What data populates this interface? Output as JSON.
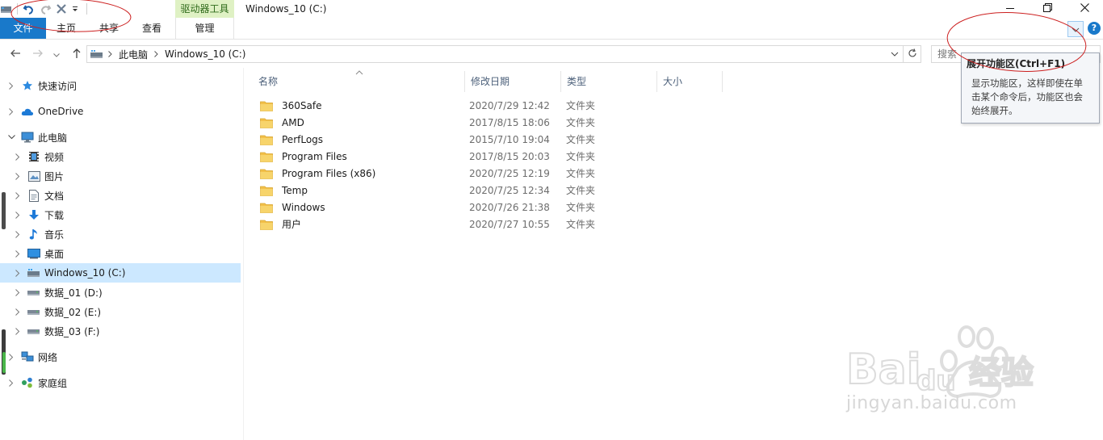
{
  "window": {
    "title": "Windows_10 (C:)",
    "context_tab_header": "驱动器工具"
  },
  "ribbon": {
    "tabs": [
      "文件",
      "主页",
      "共享",
      "查看",
      "管理"
    ]
  },
  "address": {
    "path": [
      "此电脑",
      "Windows_10 (C:)"
    ],
    "search_placeholder": "搜索"
  },
  "tooltip": {
    "title": "展开功能区(Ctrl+F1)",
    "body": [
      "显示功能区，这样即使在单",
      "击某个命令后，功能区也会",
      "始终展开。"
    ]
  },
  "tree": {
    "items": [
      {
        "label": "快速访问",
        "icon": "star-icon"
      },
      {
        "label": "OneDrive",
        "icon": "cloud-icon"
      },
      {
        "label": "此电脑",
        "icon": "computer-icon"
      },
      {
        "label": "视频",
        "icon": "video-icon"
      },
      {
        "label": "图片",
        "icon": "picture-icon"
      },
      {
        "label": "文档",
        "icon": "document-icon"
      },
      {
        "label": "下载",
        "icon": "download-icon"
      },
      {
        "label": "音乐",
        "icon": "music-icon"
      },
      {
        "label": "桌面",
        "icon": "desktop-icon"
      },
      {
        "label": "Windows_10 (C:)",
        "icon": "system-drive-icon"
      },
      {
        "label": "数据_01 (D:)",
        "icon": "drive-icon"
      },
      {
        "label": "数据_02 (E:)",
        "icon": "drive-icon"
      },
      {
        "label": "数据_03 (F:)",
        "icon": "drive-icon"
      },
      {
        "label": "网络",
        "icon": "network-icon"
      },
      {
        "label": "家庭组",
        "icon": "homegroup-icon"
      }
    ]
  },
  "columns": [
    "名称",
    "修改日期",
    "类型",
    "大小"
  ],
  "files": [
    {
      "name": "360Safe",
      "date": "2020/7/29 12:42",
      "type": "文件夹"
    },
    {
      "name": "AMD",
      "date": "2017/8/15 18:06",
      "type": "文件夹"
    },
    {
      "name": "PerfLogs",
      "date": "2015/7/10 19:04",
      "type": "文件夹"
    },
    {
      "name": "Program Files",
      "date": "2017/8/15 20:03",
      "type": "文件夹"
    },
    {
      "name": "Program Files (x86)",
      "date": "2020/7/25 12:19",
      "type": "文件夹"
    },
    {
      "name": "Temp",
      "date": "2020/7/25 12:34",
      "type": "文件夹"
    },
    {
      "name": "Windows",
      "date": "2020/7/26 21:38",
      "type": "文件夹"
    },
    {
      "name": "用户",
      "date": "2020/7/27 10:55",
      "type": "文件夹"
    }
  ],
  "watermark": {
    "url": "jingyan.baidu.com"
  },
  "colors": {
    "accent": "#1979ca",
    "selection": "#cce8ff",
    "context_tab": "#dff1c4",
    "annotation": "#cc1f1f",
    "folder": "#f5c94f"
  }
}
